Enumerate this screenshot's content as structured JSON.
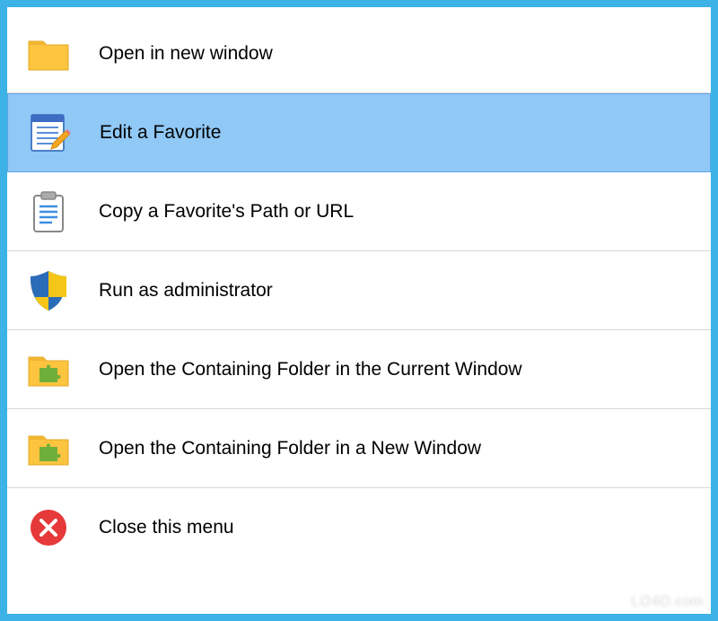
{
  "menu": {
    "items": [
      {
        "icon": "folder-icon",
        "label": "Open in new window",
        "highlighted": false
      },
      {
        "icon": "edit-favorite-icon",
        "label": "Edit a Favorite",
        "highlighted": true
      },
      {
        "icon": "clipboard-icon",
        "label": "Copy a Favorite's Path or URL",
        "highlighted": false
      },
      {
        "icon": "shield-icon",
        "label": "Run as administrator",
        "highlighted": false
      },
      {
        "icon": "folder-puzzle-icon",
        "label": "Open the Containing Folder in the Current Window",
        "highlighted": false
      },
      {
        "icon": "folder-puzzle-icon",
        "label": "Open the Containing Folder in a New Window",
        "highlighted": false
      },
      {
        "icon": "close-icon",
        "label": "Close this menu",
        "highlighted": false
      }
    ]
  },
  "watermark": "LO4D.com",
  "colors": {
    "window_border": "#3cb2e6",
    "highlight_bg": "#90c8f6",
    "highlight_border": "#5ba8e8",
    "folder_yellow": "#fdc43f",
    "shield_blue": "#2b6cb8",
    "shield_yellow": "#f5c518",
    "close_red": "#e63939"
  }
}
